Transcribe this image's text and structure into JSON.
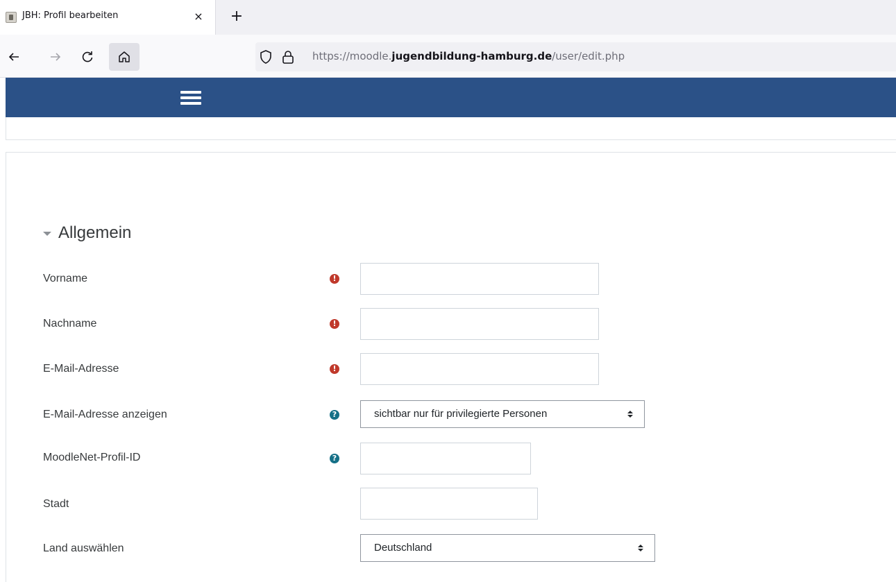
{
  "browser": {
    "tab_title": "JBH: Profil bearbeiten",
    "tab_close": "×",
    "new_tab": "+",
    "url_prefix": "https://moodle.",
    "url_host": "jugendbildung-hamburg.de",
    "url_path": "/user/edit.php"
  },
  "form": {
    "section_title": "Allgemein",
    "required_mark": "!",
    "help_mark": "?",
    "fields": {
      "firstname": {
        "label": "Vorname",
        "value": ""
      },
      "lastname": {
        "label": "Nachname",
        "value": ""
      },
      "email": {
        "label": "E-Mail-Adresse",
        "value": ""
      },
      "maildisplay": {
        "label": "E-Mail-Adresse anzeigen",
        "selected": "sichtbar nur für privilegierte Personen"
      },
      "moodlenet": {
        "label": "MoodleNet-Profil-ID",
        "value": ""
      },
      "city": {
        "label": "Stadt",
        "value": ""
      },
      "country": {
        "label": "Land auswählen",
        "selected": "Deutschland"
      }
    }
  },
  "colors": {
    "header": "#2b5187",
    "required": "#c0392b",
    "help": "#157087"
  }
}
